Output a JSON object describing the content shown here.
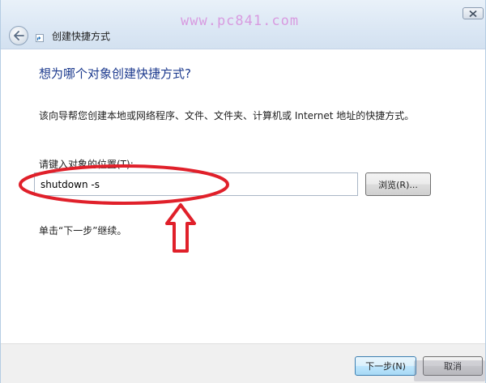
{
  "window": {
    "title": "创建快捷方式",
    "watermark": "www.pc841.com"
  },
  "page": {
    "heading": "想为哪个对象创建快捷方式?",
    "description": "该向导帮您创建本地或网络程序、文件、文件夹、计算机或 Internet 地址的快捷方式。",
    "target_label": "请键入对象的位置(T):",
    "target_value": "shutdown -s",
    "browse_label": "浏览(R)...",
    "hint": "单击“下一步”继续。"
  },
  "footer": {
    "next_label": "下一步(N)",
    "cancel_label": "取消"
  },
  "icons": {
    "back": "back-arrow-icon",
    "wizard": "shortcut-icon",
    "close": "close-icon"
  },
  "colors": {
    "heading": "#1c3a8e",
    "annotation": "#e0202a",
    "watermark": "#d89be0",
    "titlebar": "#dbe7f4"
  }
}
